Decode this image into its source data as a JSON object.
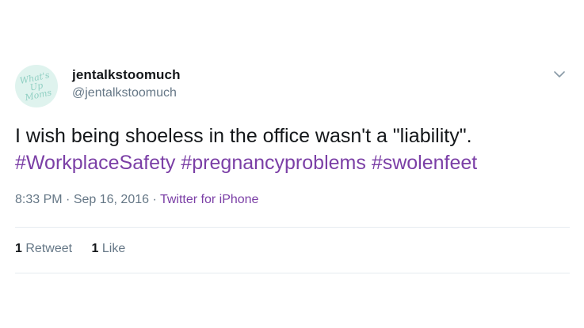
{
  "user": {
    "avatar_text": "What's\nUp\nMoms",
    "display_name": "jentalkstoomuch",
    "handle": "@jentalkstoomuch"
  },
  "tweet": {
    "text": "I wish being shoeless in the office wasn't a \"liability\".",
    "hashtags": [
      "#WorkplaceSafety",
      "#pregnancyproblems",
      "#swolenfeet"
    ]
  },
  "meta": {
    "time": "8:33 PM",
    "separator": " · ",
    "date": "Sep 16, 2016",
    "source": "Twitter for iPhone"
  },
  "stats": {
    "retweets_count": "1",
    "retweets_label": "Retweet",
    "likes_count": "1",
    "likes_label": "Like"
  },
  "icons": {
    "menu": "chevron-down-icon"
  },
  "colors": {
    "hashtag": "#7b3fa6",
    "secondary_text": "#657786",
    "avatar_bg": "#dff3ee",
    "divider": "#e6ecf0"
  }
}
